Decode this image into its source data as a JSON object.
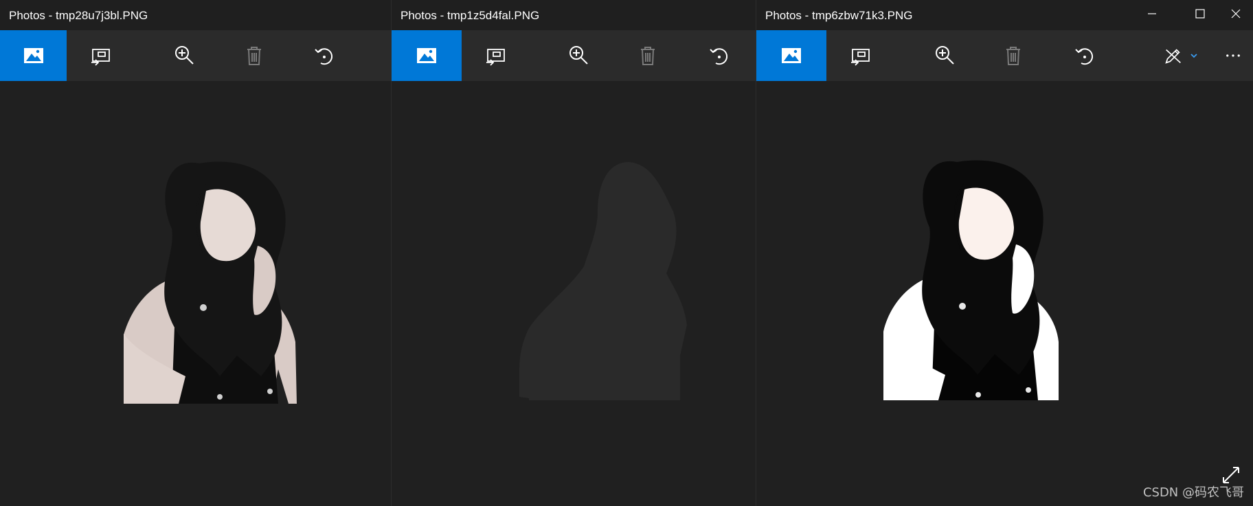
{
  "windows": [
    {
      "title": "Photos - tmp28u7j3bl.PNG"
    },
    {
      "title": "Photos - tmp1z5d4fal.PNG"
    },
    {
      "title": "Photos - tmp6zbw71k3.PNG"
    }
  ],
  "toolbar_icons": [
    "image-icon",
    "slideshow-icon",
    "zoom-in-icon",
    "trash-icon",
    "rotate-icon",
    "edit-draw-icon",
    "more-icon"
  ],
  "caption_icons": [
    "minimize-icon",
    "maximize-icon",
    "close-icon"
  ],
  "watermark": "CSDN @码农飞哥",
  "colors": {
    "accent": "#0078d7",
    "titlebar": "#1f1f1f",
    "toolbar": "#2b2b2b",
    "canvas": "#202020"
  }
}
